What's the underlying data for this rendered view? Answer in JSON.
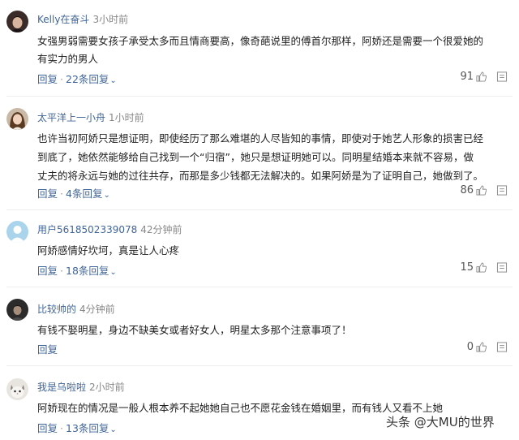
{
  "comments": [
    {
      "username": "Kelly在奋斗",
      "time": "3小时前",
      "lines": [
        "女强男弱需要女孩子承受太多而且情商要高，像奇葩说里的傅首尔那样，阿娇还是需要一个很爱她的",
        "有实力的男人"
      ],
      "reply_label": "回复",
      "replies_label": "22条回复",
      "likes": "91",
      "avatar_icon": "avatar-dark-hair-icon"
    },
    {
      "username": "太平洋上一小舟",
      "time": "1小时前",
      "lines": [
        "也许当初阿娇只是想证明，即使经历了那么难堪的人尽皆知的事情，即使对于她艺人形象的损害已经",
        "到底了，她依然能够给自己找到一个“归宿”，她只是想证明她可以。同明星结婚本来就不容易，做",
        "丈夫的将永远与她的过往共存，而那是多少钱都无法解决的。如果阿娇是为了证明自己，她做到了。"
      ],
      "reply_label": "回复",
      "replies_label": "4条回复",
      "likes": "86",
      "avatar_icon": "avatar-woman-icon"
    },
    {
      "username": "用户5618502339078",
      "time": "42分钟前",
      "lines": [
        "阿娇感情好坎坷，真是让人心疼"
      ],
      "reply_label": "回复",
      "replies_label": "18条回复",
      "likes": "15",
      "avatar_icon": "avatar-default-icon"
    },
    {
      "username": "比较帅的",
      "time": "4分钟前",
      "lines": [
        "有钱不娶明星，身边不缺美女或者好女人，明星太多那个注意事项了！"
      ],
      "reply_label": "回复",
      "replies_label": "",
      "likes": "0",
      "avatar_icon": "avatar-dark-icon"
    },
    {
      "username": "我是乌啦啦",
      "time": "2小时前",
      "lines": [
        "阿娇现在的情况是一般人根本养不起她她自己也不愿花金钱在婚姻里，而有钱人又看不上她"
      ],
      "reply_label": "回复",
      "replies_label": "13条回复",
      "likes": "",
      "avatar_icon": "avatar-cat-icon"
    }
  ],
  "watermark": "头条 @大MU的世界",
  "colors": {
    "link": "#406599",
    "time": "#888888",
    "text": "#222222"
  }
}
